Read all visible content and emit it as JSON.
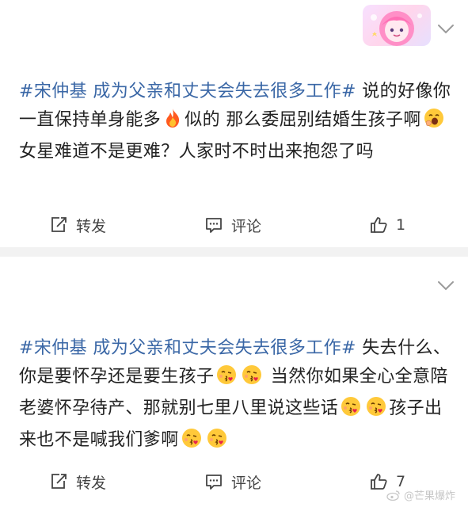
{
  "posts": [
    {
      "hashtag": "#宋仲基 成为父亲和丈夫会失去很多工作#",
      "text_a": " 说的好像你一直保持单身能多",
      "text_b": "似的 那么委屈别结婚生孩子啊",
      "text_c": " 女星难道不是更难？人家时不时出来抱怨了吗",
      "emojis": [
        "fire-emoji",
        "yawning-face-emoji"
      ],
      "actions": {
        "repost": "转发",
        "comment": "评论",
        "like_count": "1"
      }
    },
    {
      "hashtag": "#宋仲基 成为父亲和丈夫会失去很多工作#",
      "text_a": " 失去什么、你是要怀孕还是要生孩子",
      "text_b": " 当然你如果全心全意陪老婆怀孕待产、那就别七里八里说这些话",
      "text_c": "孩子出来也不是喊我们爹啊",
      "emojis": [
        "face-blowing-kiss-emoji"
      ],
      "actions": {
        "repost": "转发",
        "comment": "评论",
        "like_count": "7"
      }
    }
  ],
  "watermark": "@芒果爆炸",
  "colors": {
    "hashtag": "#3a67a6",
    "background": "#f2f2f2",
    "card": "#ffffff"
  }
}
